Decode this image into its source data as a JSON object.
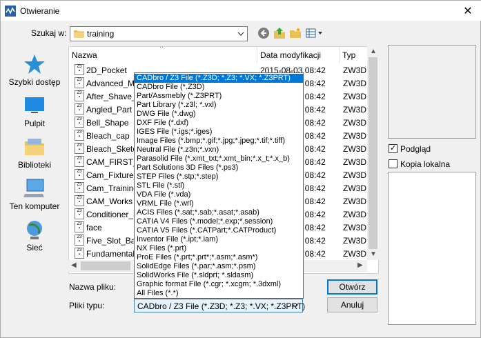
{
  "window": {
    "title": "Otwieranie",
    "close_glyph": "✕"
  },
  "toolbar": {
    "look_in_label": "Szukaj w:",
    "look_in_value": "training",
    "icons": [
      "back-icon",
      "up-folder-icon",
      "new-folder-icon",
      "view-menu-icon"
    ]
  },
  "places": [
    {
      "label": "Szybki dostęp",
      "icon": "quick-access-star-icon"
    },
    {
      "label": "Pulpit",
      "icon": "desktop-icon"
    },
    {
      "label": "Biblioteki",
      "icon": "libraries-icon"
    },
    {
      "label": "Ten komputer",
      "icon": "computer-icon"
    },
    {
      "label": "Sieć",
      "icon": "network-icon"
    }
  ],
  "file_list": {
    "columns": [
      "Nazwa",
      "Data modyfikacji",
      "Typ"
    ],
    "rows": [
      {
        "name": "2D_Pocket",
        "date": "2015-08-03 08:42",
        "type": "ZW3D"
      },
      {
        "name": "Advanced_M",
        "date": "2015-08-03 08:42",
        "type": "ZW3D"
      },
      {
        "name": "After_Shave_S",
        "date": "2015-08-03 08:42",
        "type": "ZW3D"
      },
      {
        "name": "Angled_Part",
        "date": "2015-08-03 08:42",
        "type": "ZW3D"
      },
      {
        "name": "Bell_Shape",
        "date": "2015-08-03 08:42",
        "type": "ZW3D"
      },
      {
        "name": "Bleach_cap",
        "date": "2015-08-03 08:42",
        "type": "ZW3D"
      },
      {
        "name": "Bleach_Sketcl",
        "date": "2015-08-03 08:42",
        "type": "ZW3D"
      },
      {
        "name": "CAM_FIRST_L",
        "date": "2015-08-03 08:42",
        "type": "ZW3D"
      },
      {
        "name": "Cam_Fixture_",
        "date": "2015-08-03 08:42",
        "type": "ZW3D"
      },
      {
        "name": "Cam_Training",
        "date": "2015-08-03 08:42",
        "type": "ZW3D"
      },
      {
        "name": "CAM_Works",
        "date": "2015-08-03 08:42",
        "type": "ZW3D"
      },
      {
        "name": "Conditioner_S",
        "date": "2015-08-03 08:42",
        "type": "ZW3D"
      },
      {
        "name": "face",
        "date": "2015-08-03 08:42",
        "type": "ZW3D"
      },
      {
        "name": "Five_Slot_Bas",
        "date": "2015-08-03 08:42",
        "type": "ZW3D"
      },
      {
        "name": "Fundamental",
        "date": "2015-08-03 08:42",
        "type": "ZW3D"
      }
    ]
  },
  "right_panel": {
    "preview_label": "Podgląd",
    "preview_checked": true,
    "local_copy_label": "Kopia lokalna",
    "local_copy_checked": false
  },
  "form": {
    "filename_label": "Nazwa pliku:",
    "filetype_label": "Pliki typu:",
    "filetype_value": "CADbro / Z3 File (*.Z3D; *.Z3; *.VX; *.Z3PRT)",
    "open_button": "Otwórz",
    "cancel_button": "Anuluj"
  },
  "filetype_dropdown": {
    "selected_index": 0,
    "options": [
      "CADbro / Z3 File (*.Z3D; *.Z3; *.VX; *.Z3PRT)",
      "CADbro File (*.Z3D)",
      "Part/Assmebly (*.Z3PRT)",
      "Part Library (*.z3l; *.vxl)",
      "DWG File (*.dwg)",
      "DXF File (*.dxf)",
      "IGES File (*.igs;*.iges)",
      "Image Files (*.bmp;*.gif;*.jpg;*.jpeg;*.tif;*.tiff)",
      "Neutral File (*.z3n;*.vxn)",
      "Parasolid File (*.xmt_txt;*.xmt_bin;*.x_t;*.x_b)",
      "Part Solutions 3D Files (*.ps3)",
      "STEP Files (*.stp;*.step)",
      "STL File (*.stl)",
      "VDA File (*.vda)",
      "VRML File (*.wrl)",
      "ACIS Files (*.sat;*.sab;*.asat;*.asab)",
      "CATIA V4 Files (*.model;*.exp;*.session)",
      "CATIA V5 Files (*.CATPart;*.CATProduct)",
      "Inventor File (*.ipt;*.iam)",
      "NX Files (*.prt)",
      "ProE Files (*.prt;*.prt*;*.asm;*.asm*)",
      "SolidEdge Files (*.par;*.asm;*.psm)",
      "SolidWorks File (*.sldprt; *.sldasm)",
      "Graphic format File (*.cgr; *.xcgm; *.3dxml)",
      "All Files (*.*)"
    ]
  },
  "colors": {
    "selection": "#0078d7",
    "window_bg": "#f0f0f0",
    "star": "#2a8fd6",
    "folder": "#e8c15a"
  }
}
